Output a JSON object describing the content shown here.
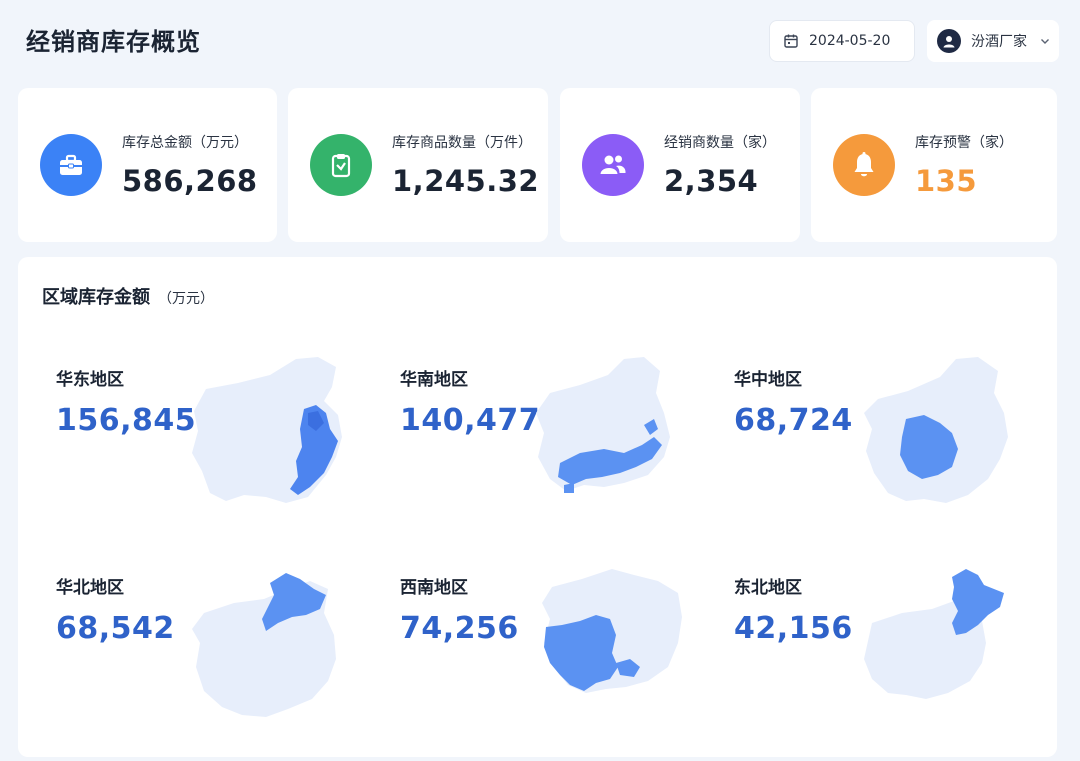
{
  "header": {
    "title": "经销商库存概览",
    "date": "2024-05-20",
    "user": "汾酒厂家"
  },
  "kpis": [
    {
      "label": "库存总金额（万元）",
      "value": "586,268",
      "icon": "briefcase-icon",
      "color": "#3b82f6"
    },
    {
      "label": "库存商品数量（万件）",
      "value": "1,245.32",
      "icon": "clipboard-icon",
      "color": "#34b36b"
    },
    {
      "label": "经销商数量（家）",
      "value": "2,354",
      "icon": "users-icon",
      "color": "#8b5cf6"
    },
    {
      "label": "库存预警（家）",
      "value": "135",
      "icon": "bell-icon",
      "color": "#f59a3c"
    }
  ],
  "region_section": {
    "title": "区域库存金额",
    "unit": "（万元）"
  },
  "regions": [
    {
      "name": "华东地区",
      "value": "156,845",
      "highlight": "east"
    },
    {
      "name": "华南地区",
      "value": "140,477",
      "highlight": "south"
    },
    {
      "name": "华中地区",
      "value": "68,724",
      "highlight": "central"
    },
    {
      "name": "华北地区",
      "value": "68,542",
      "highlight": "north"
    },
    {
      "name": "西南地区",
      "value": "74,256",
      "highlight": "southwest"
    },
    {
      "name": "东北地区",
      "value": "42,156",
      "highlight": "northeast"
    }
  ],
  "colors": {
    "accent": "#2f62c9",
    "map_base": "#e7eefb",
    "map_highlight": "#5b92f2"
  }
}
